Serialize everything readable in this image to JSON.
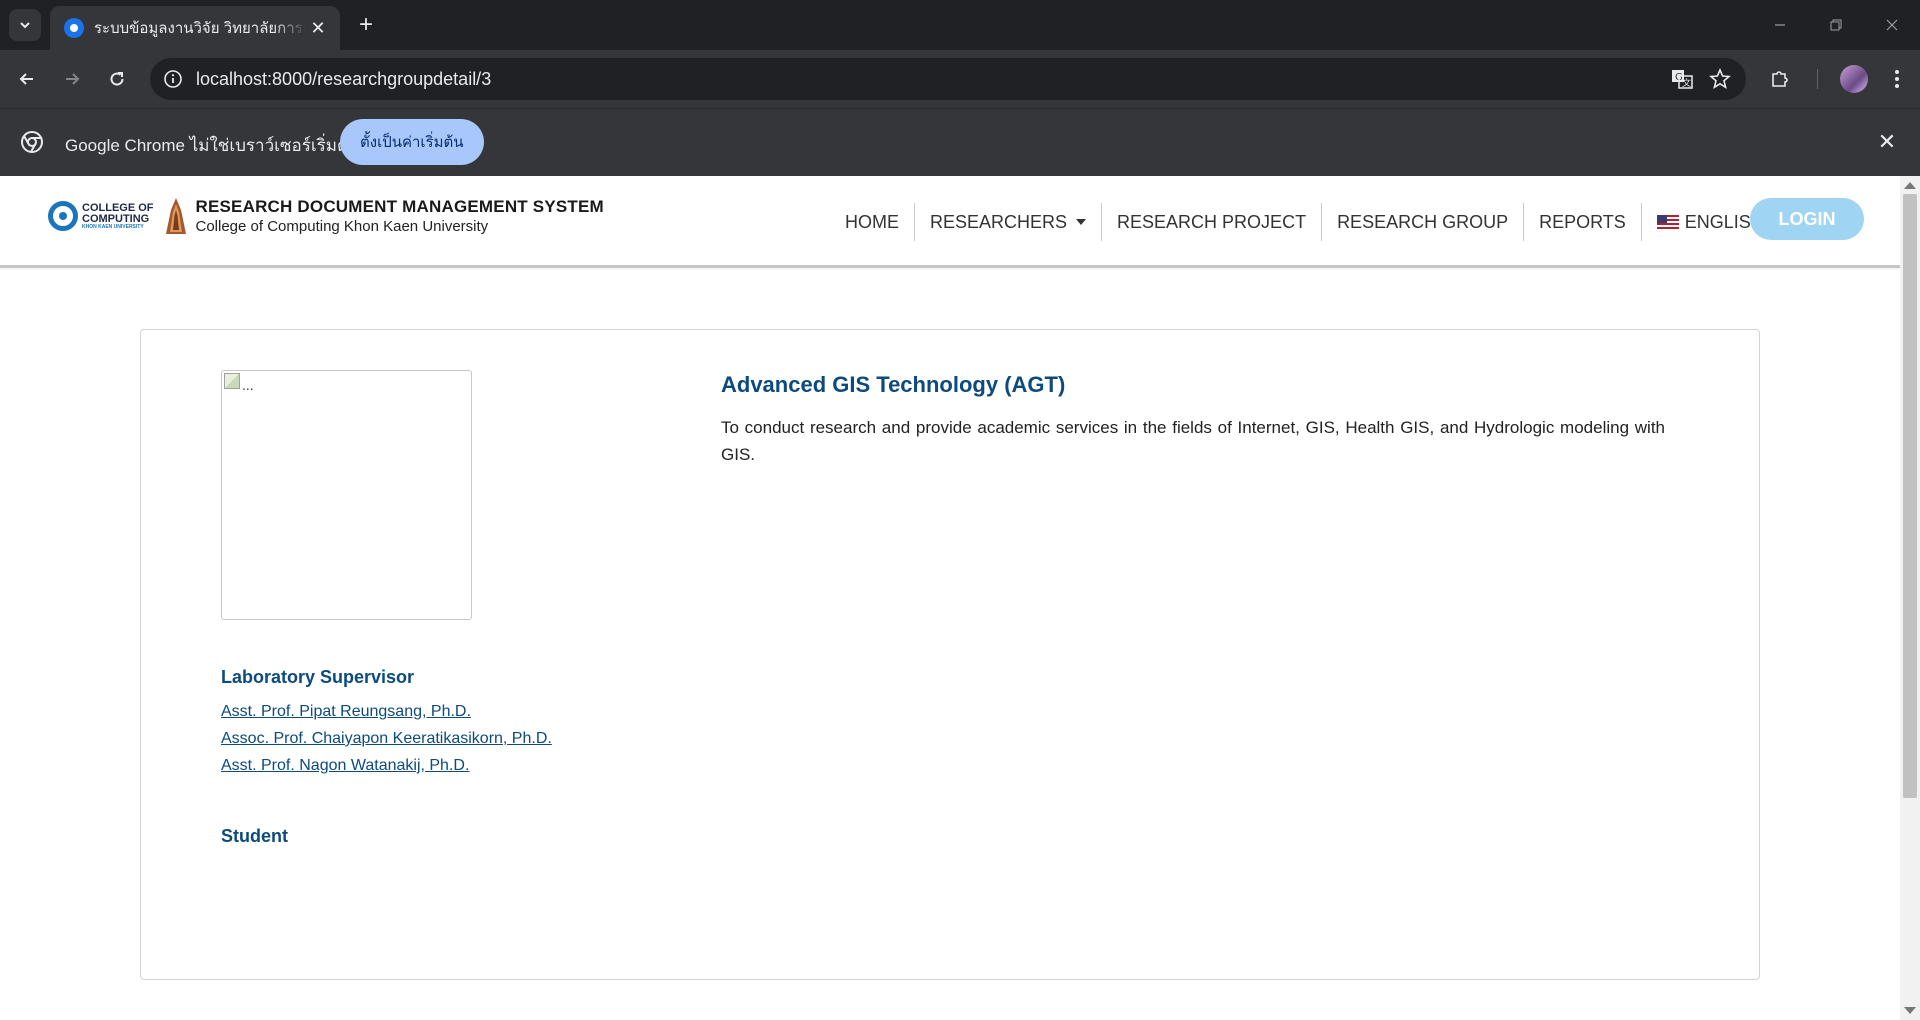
{
  "browser": {
    "tab": {
      "title": "ระบบข้อมูลงานวิจัย วิทยาลัยการคอมพิวเตอร์"
    },
    "new_tab_symbol": "+",
    "url": "localhost:8000/researchgroupdetail/3",
    "infobar": {
      "message": "Google Chrome ไม่ใช่เบราว์เซอร์เริ่มต้น",
      "button_label": "ตั้งเป็นค่าเริ่มต้น"
    }
  },
  "site": {
    "logo": {
      "line1": "COLLEGE OF",
      "line2": "COMPUTING",
      "line3": "KHON KAEN UNIVERSITY"
    },
    "title": "RESEARCH DOCUMENT MANAGEMENT SYSTEM",
    "subtitle": "College of Computing Khon Kaen University",
    "nav": {
      "home": "HOME",
      "researchers": "RESEARCHERS",
      "research_project": "RESEARCH PROJECT",
      "research_group": "RESEARCH GROUP",
      "reports": "REPORTS",
      "language": "ENGLISH"
    },
    "login_label": "LOGIN"
  },
  "group": {
    "image_alt": "...",
    "name": "Advanced GIS Technology (AGT)",
    "description": "To conduct research and provide academic services in the fields of Internet, GIS, Health GIS, and Hydrologic modeling with GIS.",
    "supervisor_heading": "Laboratory Supervisor",
    "supervisors": [
      "Asst. Prof. Pipat Reungsang, Ph.D.",
      "Assoc. Prof. Chaiyapon Keeratikasikorn, Ph.D.",
      "Asst. Prof. Nagon Watanakij, Ph.D."
    ],
    "student_heading": "Student"
  },
  "colors": {
    "heading_blue": "#0d4a7d",
    "login_button": "#9fd4f2",
    "browser_dark": "#202124",
    "browser_toolbar": "#35363a",
    "infobar_button": "#a8c7fa"
  }
}
